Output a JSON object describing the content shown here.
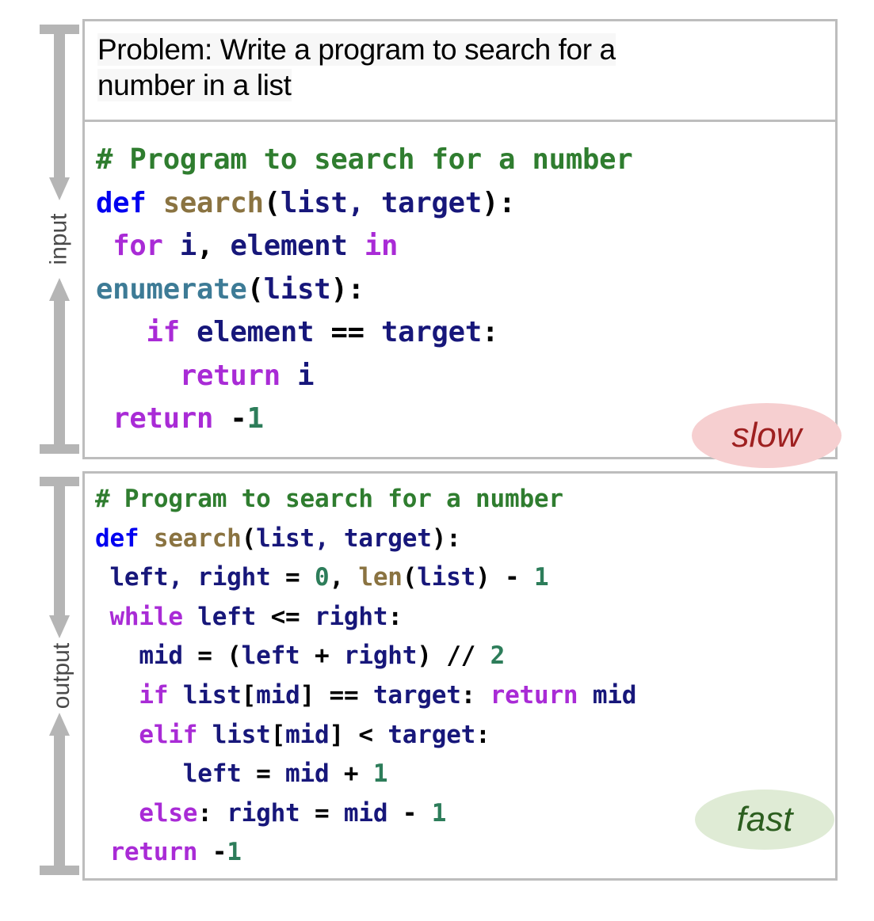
{
  "rails": [
    {
      "name": "input",
      "label": "input"
    },
    {
      "name": "output",
      "label": "output"
    }
  ],
  "problem": {
    "label": "Problem: Write a program to search for a number in a list",
    "line1": "Problem: Write a program to search for a",
    "line2": "number in a list"
  },
  "input_panel": {
    "badge": "slow",
    "badge_bg": "#f6cfd0",
    "badge_fg": "#9e2020",
    "code_lines": [
      [
        {
          "t": "# Program to search for a number",
          "c": "t-com"
        }
      ],
      [
        {
          "t": "def ",
          "c": "t-def"
        },
        {
          "t": "search",
          "c": "t-fn"
        },
        {
          "t": "(",
          "c": "t-pun"
        },
        {
          "t": "list, target",
          "c": "t-var"
        },
        {
          "t": "):",
          "c": "t-pun"
        }
      ],
      [
        {
          "t": " ",
          "c": "t-pun"
        },
        {
          "t": "for ",
          "c": "t-kw"
        },
        {
          "t": "i",
          "c": "t-var"
        },
        {
          "t": ",",
          "c": "t-pun"
        },
        {
          "t": " element ",
          "c": "t-var"
        },
        {
          "t": "in",
          "c": "t-kw"
        }
      ],
      [
        {
          "t": "enumerate",
          "c": "t-blt"
        },
        {
          "t": "(",
          "c": "t-pun"
        },
        {
          "t": "list",
          "c": "t-var"
        },
        {
          "t": "):",
          "c": "t-pun"
        }
      ],
      [
        {
          "t": "   ",
          "c": "t-pun"
        },
        {
          "t": "if ",
          "c": "t-kw"
        },
        {
          "t": "element ",
          "c": "t-var"
        },
        {
          "t": "==",
          "c": "t-op"
        },
        {
          "t": " target",
          "c": "t-var"
        },
        {
          "t": ":",
          "c": "t-pun"
        }
      ],
      [
        {
          "t": "     ",
          "c": "t-pun"
        },
        {
          "t": "return ",
          "c": "t-kw"
        },
        {
          "t": "i",
          "c": "t-var"
        }
      ],
      [
        {
          "t": " ",
          "c": "t-pun"
        },
        {
          "t": "return ",
          "c": "t-kw"
        },
        {
          "t": "-",
          "c": "t-op"
        },
        {
          "t": "1",
          "c": "t-num"
        }
      ]
    ]
  },
  "output_panel": {
    "badge": "fast",
    "badge_bg": "#dfebd5",
    "badge_fg": "#2c5e1f",
    "code_lines": [
      [
        {
          "t": "# Program to search for a number",
          "c": "t-com"
        }
      ],
      [
        {
          "t": "def ",
          "c": "t-def"
        },
        {
          "t": "search",
          "c": "t-fn"
        },
        {
          "t": "(",
          "c": "t-pun"
        },
        {
          "t": "list, target",
          "c": "t-var"
        },
        {
          "t": "):",
          "c": "t-pun"
        }
      ],
      [
        {
          "t": " left, right ",
          "c": "t-var"
        },
        {
          "t": "=",
          "c": "t-op"
        },
        {
          "t": " ",
          "c": "t-pun"
        },
        {
          "t": "0",
          "c": "t-num"
        },
        {
          "t": ", ",
          "c": "t-pun"
        },
        {
          "t": "len",
          "c": "t-fn"
        },
        {
          "t": "(",
          "c": "t-pun"
        },
        {
          "t": "list",
          "c": "t-var"
        },
        {
          "t": ") ",
          "c": "t-pun"
        },
        {
          "t": "-",
          "c": "t-op"
        },
        {
          "t": " ",
          "c": "t-pun"
        },
        {
          "t": "1",
          "c": "t-num"
        }
      ],
      [
        {
          "t": " ",
          "c": "t-pun"
        },
        {
          "t": "while ",
          "c": "t-kw"
        },
        {
          "t": "left ",
          "c": "t-var"
        },
        {
          "t": "<=",
          "c": "t-op"
        },
        {
          "t": " right",
          "c": "t-var"
        },
        {
          "t": ":",
          "c": "t-pun"
        }
      ],
      [
        {
          "t": "   mid ",
          "c": "t-var"
        },
        {
          "t": "=",
          "c": "t-op"
        },
        {
          "t": " ",
          "c": "t-pun"
        },
        {
          "t": "(",
          "c": "t-pun"
        },
        {
          "t": "left ",
          "c": "t-var"
        },
        {
          "t": "+",
          "c": "t-op"
        },
        {
          "t": " right",
          "c": "t-var"
        },
        {
          "t": ") ",
          "c": "t-pun"
        },
        {
          "t": "//",
          "c": "t-op"
        },
        {
          "t": " ",
          "c": "t-pun"
        },
        {
          "t": "2",
          "c": "t-num"
        }
      ],
      [
        {
          "t": "   ",
          "c": "t-pun"
        },
        {
          "t": "if ",
          "c": "t-kw"
        },
        {
          "t": "list",
          "c": "t-var"
        },
        {
          "t": "[",
          "c": "t-pun"
        },
        {
          "t": "mid",
          "c": "t-var"
        },
        {
          "t": "] ",
          "c": "t-pun"
        },
        {
          "t": "==",
          "c": "t-op"
        },
        {
          "t": " target",
          "c": "t-var"
        },
        {
          "t": ": ",
          "c": "t-pun"
        },
        {
          "t": "return ",
          "c": "t-kw"
        },
        {
          "t": "mid",
          "c": "t-var"
        }
      ],
      [
        {
          "t": "   ",
          "c": "t-pun"
        },
        {
          "t": "elif ",
          "c": "t-kw"
        },
        {
          "t": "list",
          "c": "t-var"
        },
        {
          "t": "[",
          "c": "t-pun"
        },
        {
          "t": "mid",
          "c": "t-var"
        },
        {
          "t": "] ",
          "c": "t-pun"
        },
        {
          "t": "<",
          "c": "t-op"
        },
        {
          "t": " target",
          "c": "t-var"
        },
        {
          "t": ":",
          "c": "t-pun"
        }
      ],
      [
        {
          "t": "      left ",
          "c": "t-var"
        },
        {
          "t": "=",
          "c": "t-op"
        },
        {
          "t": " mid ",
          "c": "t-var"
        },
        {
          "t": "+",
          "c": "t-op"
        },
        {
          "t": " ",
          "c": "t-pun"
        },
        {
          "t": "1",
          "c": "t-num"
        }
      ],
      [
        {
          "t": "   ",
          "c": "t-pun"
        },
        {
          "t": "else",
          "c": "t-kw"
        },
        {
          "t": ": ",
          "c": "t-pun"
        },
        {
          "t": "right ",
          "c": "t-var"
        },
        {
          "t": "=",
          "c": "t-op"
        },
        {
          "t": " mid ",
          "c": "t-var"
        },
        {
          "t": "-",
          "c": "t-op"
        },
        {
          "t": " ",
          "c": "t-pun"
        },
        {
          "t": "1",
          "c": "t-num"
        }
      ],
      [
        {
          "t": " ",
          "c": "t-pun"
        },
        {
          "t": "return ",
          "c": "t-kw"
        },
        {
          "t": "-",
          "c": "t-op"
        },
        {
          "t": "1",
          "c": "t-num"
        }
      ]
    ]
  },
  "colors": {
    "border": "#bdbdbd",
    "rail": "#b5b5b5",
    "comment": "#2f7d2f",
    "def_keyword": "#0000f0",
    "function_name": "#8a7341",
    "keyword": "#a92bd6",
    "variable": "#17177a",
    "builtin": "#3d7b96",
    "number": "#2d7d5a",
    "operator": "#000000"
  }
}
